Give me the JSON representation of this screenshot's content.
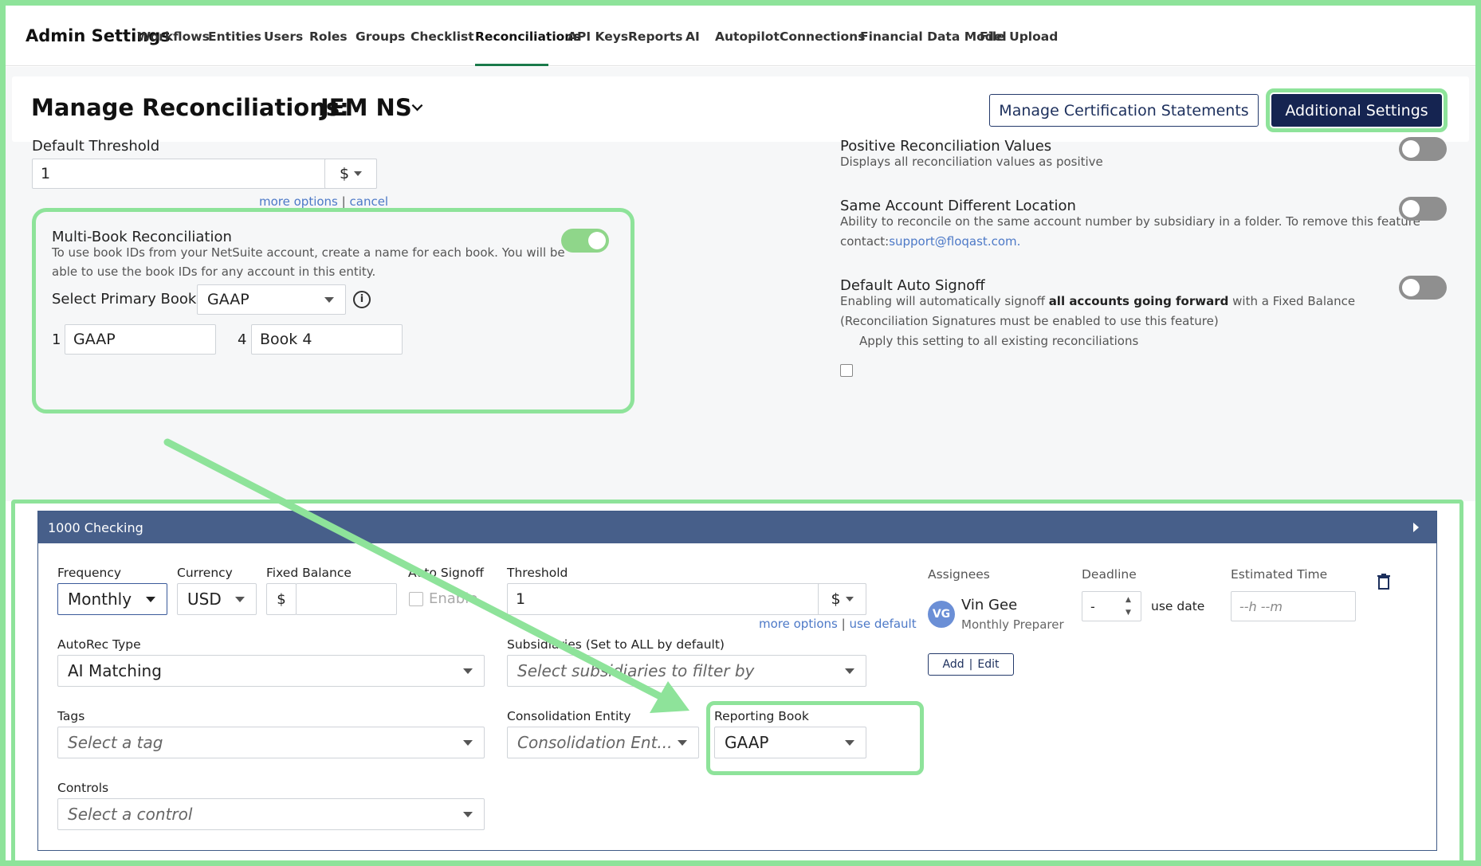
{
  "nav": {
    "brand": "Admin Settings",
    "items": [
      "Workflows",
      "Entities",
      "Users",
      "Roles",
      "Groups",
      "Checklist",
      "Reconciliations",
      "API Keys",
      "Reports",
      "AI",
      "Autopilot",
      "Connections",
      "Financial Data Model",
      "File Upload"
    ],
    "active": "Reconciliations"
  },
  "header": {
    "title": "Manage Reconciliations:",
    "entity": "JEM NS",
    "manage_cert_label": "Manage Certification Statements",
    "additional_settings_label": "Additional Settings"
  },
  "default_threshold": {
    "label": "Default Threshold",
    "value": "1",
    "unit": "$",
    "more_options": "more options",
    "separator": "|",
    "cancel": "cancel"
  },
  "multibook": {
    "title": "Multi-Book Reconciliation",
    "description_line1": "To use book IDs from your NetSuite account, create a name for each book. You will be",
    "description_line2": "able to use the book IDs for any account in this entity.",
    "enabled": true,
    "primary_label": "Select Primary Book",
    "primary_value": "GAAP",
    "books": [
      {
        "id": "1",
        "name": "GAAP"
      },
      {
        "id": "4",
        "name": "Book 4"
      }
    ]
  },
  "settings": [
    {
      "title": "Positive Reconciliation Values",
      "line1": "Displays all reconciliation values as positive",
      "enabled": false
    },
    {
      "title": "Same Account Different Location",
      "line1": "Ability to reconcile on the same account number by subsidiary in a folder. To remove this feature",
      "line2_prefix": "contact:",
      "line2_link": "support@floqast.com.",
      "enabled": false
    },
    {
      "title": "Default Auto Signoff",
      "line1_a": "Enabling will automatically signoff ",
      "line1_b": "all accounts going forward",
      "line1_c": " with a Fixed Balance",
      "line2": "(Reconciliation Signatures must be enabled to use this feature)",
      "checkbox_label": "Apply this setting to all existing reconciliations",
      "enabled": false
    }
  ],
  "account": {
    "title": "1000 Checking",
    "frequency_label": "Frequency",
    "frequency": "Monthly",
    "currency_label": "Currency",
    "currency": "USD",
    "fixed_balance_label": "Fixed Balance",
    "fixed_symbol": "$",
    "auto_signoff_label": "Auto Signoff",
    "auto_signoff_value": "Enable",
    "threshold_label": "Threshold",
    "threshold": "1",
    "threshold_unit": "$",
    "more_options": "more options",
    "separator": "|",
    "use_default": "use default",
    "autorec_label": "AutoRec Type",
    "autorec": "AI Matching",
    "subsidiaries_label": "Subsidiaries (Set to ALL by default)",
    "subsidiaries_placeholder": "Select subsidiaries to filter by",
    "tags_label": "Tags",
    "tags_placeholder": "Select a tag",
    "consolidation_label": "Consolidation Entity",
    "consolidation_placeholder": "Consolidation Ent...",
    "reporting_book_label": "Reporting Book",
    "reporting_book": "GAAP",
    "controls_label": "Controls",
    "controls_placeholder": "Select a control",
    "assignees_label": "Assignees",
    "assignee_initials": "VG",
    "assignee_name": "Vin Gee",
    "assignee_role": "Monthly Preparer",
    "add_label": "Add",
    "edit_label": "Edit",
    "deadline_label": "Deadline",
    "deadline_value": "-",
    "use_date": "use date",
    "estimated_time_label": "Estimated Time",
    "estimated_time_placeholder": "--h --m"
  },
  "colors": {
    "accent_green": "#8ee39a",
    "navy": "#152451",
    "header_blue": "#475f8a",
    "link": "#4d79c7"
  }
}
